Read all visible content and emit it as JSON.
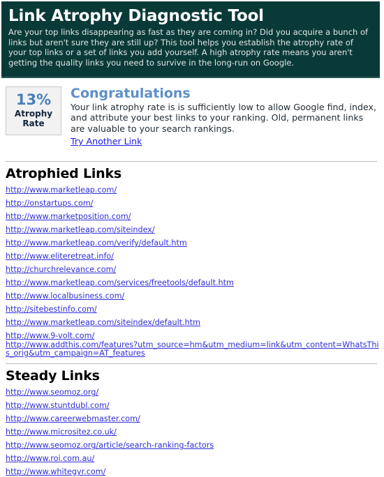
{
  "header": {
    "title": "Link Atrophy Diagnostic Tool",
    "description": "Are your top links disappearing as fast as they are coming in? Did you acquire a bunch of links but aren't sure they are still up? This tool helps you establish the atrophy rate of your top links or a set of links you add yourself. A high atrophy rate means you aren't getting the quality links you need to survive in the long-run on Google.",
    "background_color": "#0a3a38"
  },
  "result": {
    "rate_value": "13%",
    "rate_label": "Atrophy Rate",
    "rate_value_color": "#4a7ebb",
    "heading": "Congratulations",
    "heading_color": "#5b8fc9",
    "body": "Your link atrophy rate is is sufficiently low to allow Google find, index, and attribute your best links to your ranking. Old, permanent links are valuable to your search rankings.",
    "retry_link": "Try Another Link"
  },
  "atrophied": {
    "title": "Atrophied Links",
    "links": [
      "http://www.marketleap.com/",
      "http://onstartups.com/",
      "http://www.marketposition.com/",
      "http://www.marketleap.com/siteindex/",
      "http://www.marketleap.com/verify/default.htm",
      "http://www.eliteretreat.info/",
      "http://churchrelevance.com/",
      "http://www.marketleap.com/services/freetools/default.htm",
      "http://www.localbusiness.com/",
      "http://sitebestinfo.com/",
      "http://www.marketleap.com/siteindex/default.htm",
      "http://www.9-volt.com/",
      "http://www.addthis.com/features?utm_source=hm&utm_medium=link&utm_content=WhatsThis_orig&utm_campaign=AT_features"
    ]
  },
  "steady": {
    "title": "Steady Links",
    "links": [
      "http://www.seomoz.org/",
      "http://www.stuntdubl.com/",
      "http://www.careerwebmaster.com/",
      "http://www.micrositez.co.uk/",
      "http://www.seomoz.org/article/search-ranking-factors",
      "http://www.roi.com.au/",
      "http://www.whitegyr.com/"
    ]
  }
}
